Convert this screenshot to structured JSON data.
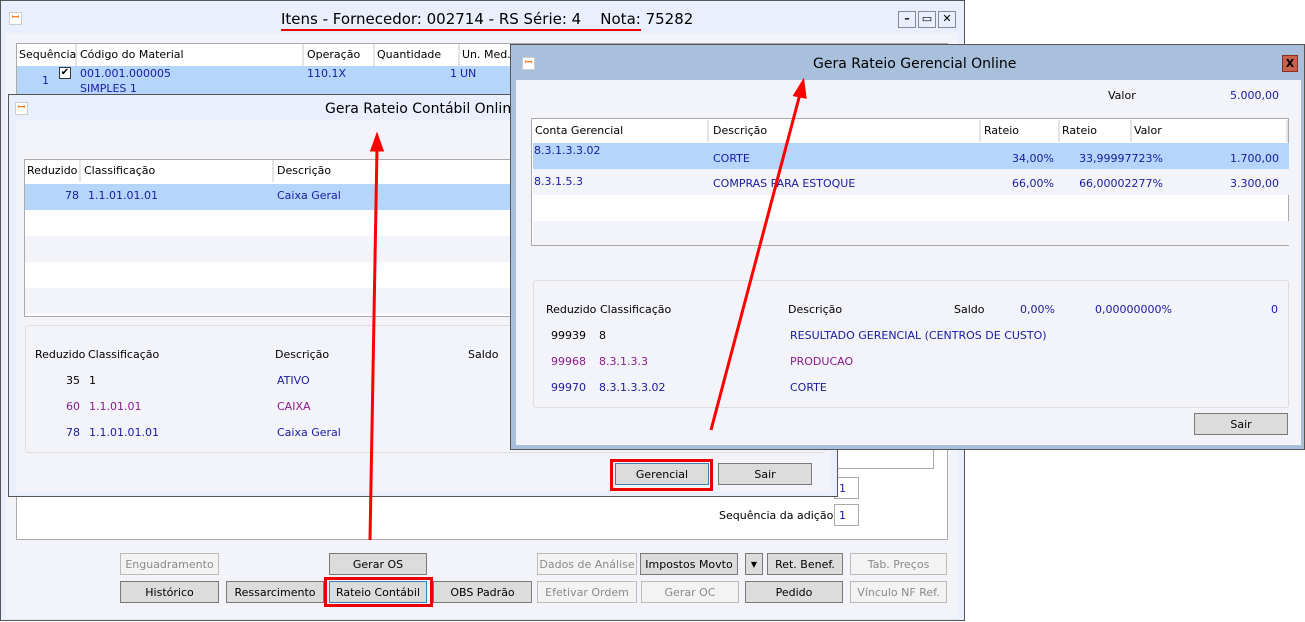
{
  "main": {
    "title": "Itens - Fornecedor: 002714 - RS Série: 4    Nota: 75282",
    "columns": [
      "Sequência",
      "Código do Material",
      "Operação",
      "Quantidade",
      "Un. Med."
    ],
    "row": {
      "seq": "1",
      "code": "001.001.000005",
      "desc": "SIMPLES 1",
      "op": "110.1X",
      "qty": "1",
      "un": "UN"
    },
    "seq_adicao_label": "Sequência da adição",
    "field1": "1",
    "field2": "1",
    "buttons_row1": [
      "Enguadramento",
      "Gerar OS",
      "Dados de Análise",
      "Impostos Movto",
      "Ret. Benef.",
      "Tab. Preços"
    ],
    "buttons_row2": [
      "Histórico",
      "Ressarcimento",
      "Rateio Contábil",
      "OBS Padrão",
      "Efetivar Ordem",
      "Gerar OC",
      "Pedido",
      "Vínculo NF Ref."
    ]
  },
  "contabil": {
    "title": "Gera Rateio Contábil Online",
    "columns": [
      "Reduzido",
      "Classificação",
      "Descrição"
    ],
    "rows": [
      {
        "red": "78",
        "cls": "1.1.01.01.01",
        "desc": "Caixa Geral"
      }
    ],
    "tree_header": [
      "Reduzido",
      "Classificação",
      "Descrição",
      "Saldo"
    ],
    "tree": [
      {
        "red": "35",
        "cls": "1",
        "desc": "ATIVO"
      },
      {
        "red": "60",
        "cls": "1.1.01.01",
        "desc": "CAIXA"
      },
      {
        "red": "78",
        "cls": "1.1.01.01.01",
        "desc": "Caixa Geral"
      }
    ],
    "gerencial_btn": "Gerencial",
    "sair_btn": "Sair"
  },
  "gerencial": {
    "title": "Gera Rateio Gerencial Online",
    "valor_label": "Valor",
    "valor": "5.000,00",
    "columns": [
      "Conta Gerencial",
      "Descrição",
      "Rateio",
      "Rateio Calculado",
      "Valor"
    ],
    "rows": [
      {
        "conta": "8.3.1.3.3.02",
        "desc": "CORTE",
        "rateio": "34,00%",
        "calc": "33,99997723%",
        "valor": "1.700,00"
      },
      {
        "conta": "8.3.1.5.3",
        "desc": "COMPRAS PARA ESTOQUE",
        "rateio": "66,00%",
        "calc": "66,00002277%",
        "valor": "3.300,00"
      }
    ],
    "tree_header": [
      "Reduzido",
      "Classificação",
      "Descrição",
      "Saldo",
      "0,00%",
      "0,00000000%",
      "0"
    ],
    "tree": [
      {
        "red": "99939",
        "cls": "8",
        "desc": "RESULTADO GERENCIAL (CENTROS DE CUSTO)"
      },
      {
        "red": "99968",
        "cls": "8.3.1.3.3",
        "desc": "PRODUCAO"
      },
      {
        "red": "99970",
        "cls": "8.3.1.3.3.02",
        "desc": "CORTE"
      }
    ],
    "sair_btn": "Sair",
    "close": "X"
  }
}
